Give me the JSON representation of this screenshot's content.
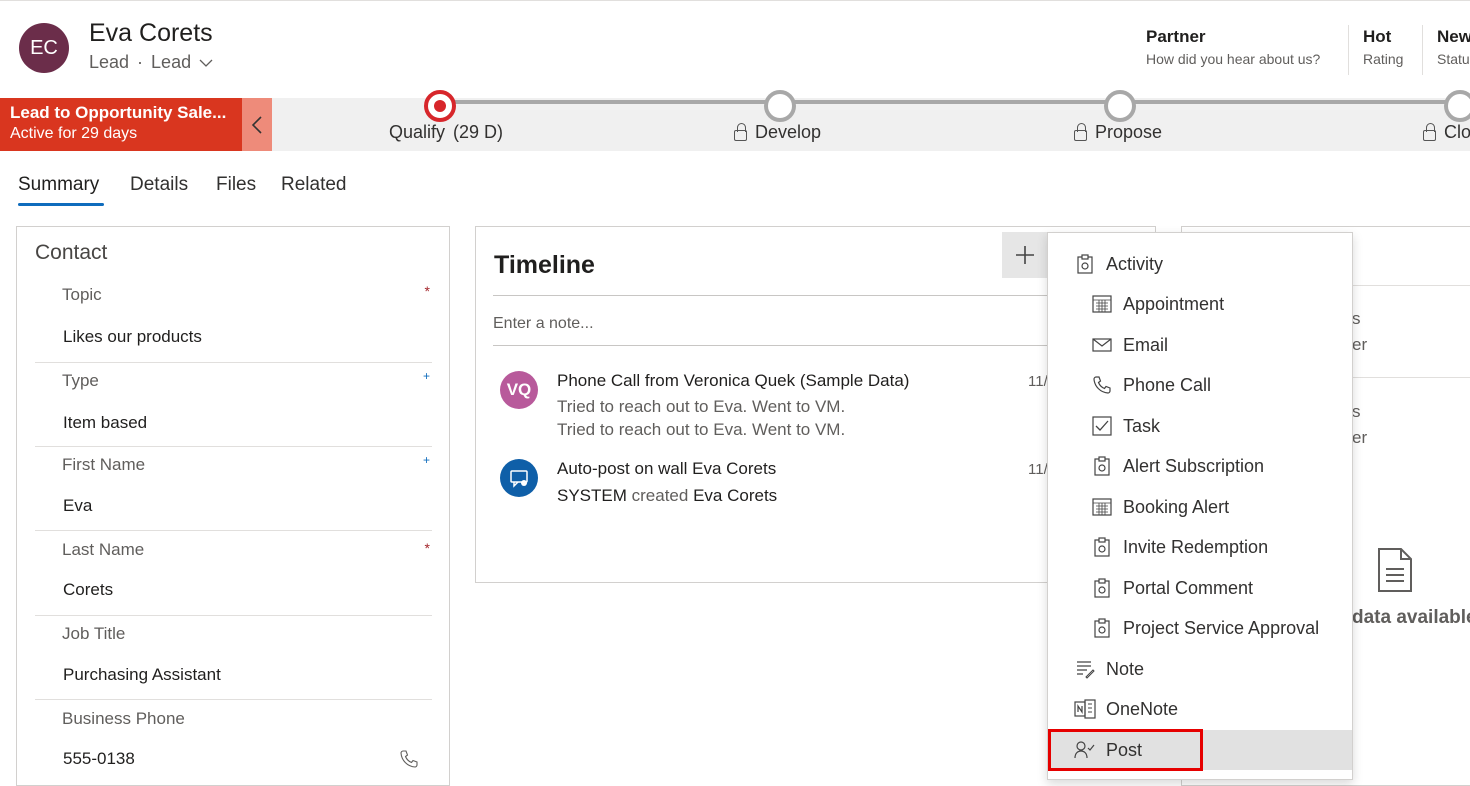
{
  "record": {
    "initials": "EC",
    "name": "Eva Corets",
    "entity": "Lead",
    "form": "Lead"
  },
  "header_fields": [
    {
      "value": "Partner",
      "label": "How did you hear about us?"
    },
    {
      "value": "Hot",
      "label": "Rating"
    },
    {
      "value": "New",
      "label": "Statu"
    }
  ],
  "bpf": {
    "name": "Lead to Opportunity Sale...",
    "status": "Active for 29 days",
    "stages": [
      {
        "label": "Qualify",
        "duration": "(29 D)",
        "active": true,
        "locked": false
      },
      {
        "label": "Develop",
        "active": false,
        "locked": true
      },
      {
        "label": "Propose",
        "active": false,
        "locked": true
      },
      {
        "label": "Clo",
        "active": false,
        "locked": true
      }
    ]
  },
  "tabs": [
    "Summary",
    "Details",
    "Files",
    "Related"
  ],
  "contact": {
    "title": "Contact",
    "fields": [
      {
        "label": "Topic",
        "value": "Likes our products",
        "marker": "*"
      },
      {
        "label": "Type",
        "value": "Item based",
        "marker": "+"
      },
      {
        "label": "First Name",
        "value": "Eva",
        "marker": "+"
      },
      {
        "label": "Last Name",
        "value": "Corets",
        "marker": "*"
      },
      {
        "label": "Job Title",
        "value": "Purchasing Assistant",
        "marker": ""
      },
      {
        "label": "Business Phone",
        "value": "555-0138",
        "marker": ""
      }
    ]
  },
  "timeline": {
    "title": "Timeline",
    "add_label": "+",
    "note_placeholder": "Enter a note...",
    "items": [
      {
        "avatar": "VQ",
        "title": "Phone Call from Veronica Quek (Sample Data)",
        "line1": "Tried to reach out to Eva. Went to VM.",
        "line2": "Tried to reach out to Eva. Went to VM.",
        "date": "11/"
      },
      {
        "title": "Auto-post on wall Eva Corets",
        "actor": "SYSTEM",
        "verb": "created",
        "target": "Eva Corets",
        "date": "11/"
      }
    ]
  },
  "right_card": {
    "frag1": "s",
    "frag2": "er",
    "frag3": "s",
    "frag4": "er",
    "no_data": "data available"
  },
  "menu": {
    "items": [
      {
        "label": "Activity",
        "icon": "activity-icon",
        "level": 1
      },
      {
        "label": "Appointment",
        "icon": "calendar-icon",
        "level": 2
      },
      {
        "label": "Email",
        "icon": "mail-icon",
        "level": 2
      },
      {
        "label": "Phone Call",
        "icon": "phone-icon",
        "level": 2
      },
      {
        "label": "Task",
        "icon": "checkbox-icon",
        "level": 2
      },
      {
        "label": "Alert Subscription",
        "icon": "activity-icon",
        "level": 2
      },
      {
        "label": "Booking Alert",
        "icon": "calendar-icon",
        "level": 2
      },
      {
        "label": "Invite Redemption",
        "icon": "activity-icon",
        "level": 2
      },
      {
        "label": "Portal Comment",
        "icon": "activity-icon",
        "level": 2
      },
      {
        "label": "Project Service Approval",
        "icon": "activity-icon",
        "level": 2
      },
      {
        "label": "Note",
        "icon": "note-icon",
        "level": 1
      },
      {
        "label": "OneNote",
        "icon": "onenote-icon",
        "level": 1
      },
      {
        "label": "Post",
        "icon": "post-icon",
        "level": 1,
        "selected": true
      }
    ]
  },
  "colors": {
    "bpf_active": "#d9361f",
    "stage_active": "#d7262b",
    "accent": "#0f6cbd",
    "avatar": "#6b2d4a",
    "highlight": "#e60000"
  }
}
